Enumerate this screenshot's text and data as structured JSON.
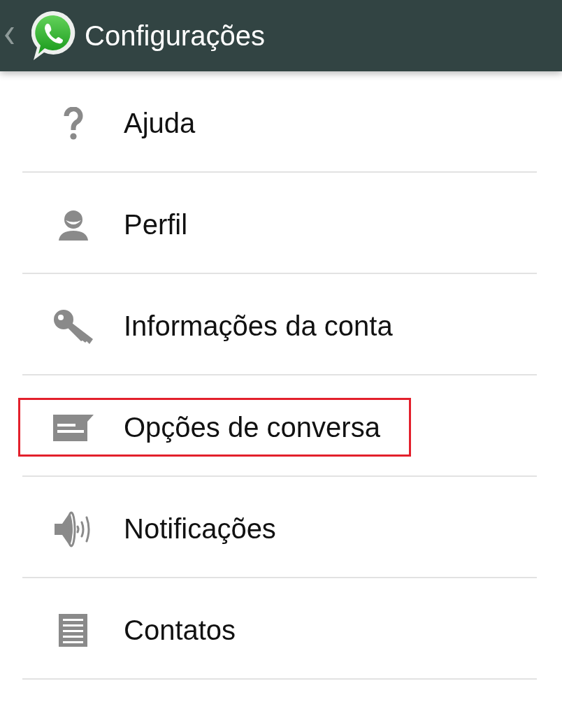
{
  "header": {
    "title": "Configurações"
  },
  "items": [
    {
      "label": "Ajuda",
      "highlighted": false
    },
    {
      "label": "Perfil",
      "highlighted": false
    },
    {
      "label": "Informações da conta",
      "highlighted": false
    },
    {
      "label": "Opções de conversa",
      "highlighted": true
    },
    {
      "label": "Notificações",
      "highlighted": false
    },
    {
      "label": "Contatos",
      "highlighted": false
    }
  ]
}
